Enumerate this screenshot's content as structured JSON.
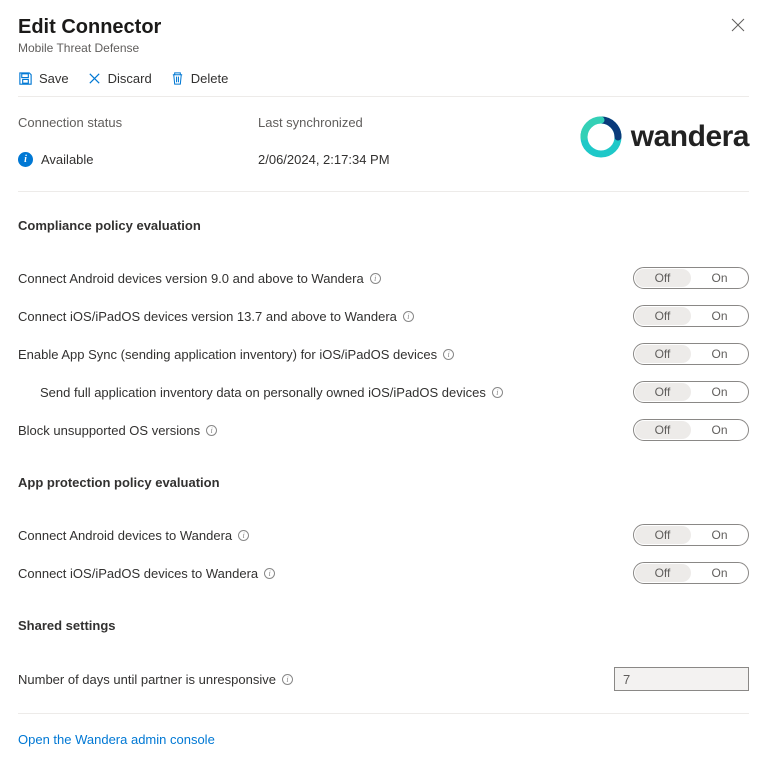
{
  "header": {
    "title": "Edit Connector",
    "subtitle": "Mobile Threat Defense"
  },
  "toolbar": {
    "save": "Save",
    "discard": "Discard",
    "delete": "Delete"
  },
  "status": {
    "conn_label": "Connection status",
    "conn_value": "Available",
    "sync_label": "Last synchronized",
    "sync_value": "2/06/2024, 2:17:34 PM",
    "logo_text": "wandera"
  },
  "sections": {
    "compliance": "Compliance policy evaluation",
    "app_protection": "App protection policy evaluation",
    "shared": "Shared settings"
  },
  "toggle_labels": {
    "off": "Off",
    "on": "On"
  },
  "rows": {
    "r1": "Connect Android devices version 9.0 and above to Wandera",
    "r2": "Connect iOS/iPadOS devices version 13.7 and above to Wandera",
    "r3": "Enable App Sync (sending application inventory) for iOS/iPadOS devices",
    "r4": "Send full application inventory data on personally owned iOS/iPadOS devices",
    "r5": "Block unsupported OS versions",
    "r6": "Connect Android devices to Wandera",
    "r7": "Connect iOS/iPadOS devices to Wandera",
    "r8": "Number of days until partner is unresponsive"
  },
  "days_value": "7",
  "footer_link": "Open the Wandera admin console"
}
